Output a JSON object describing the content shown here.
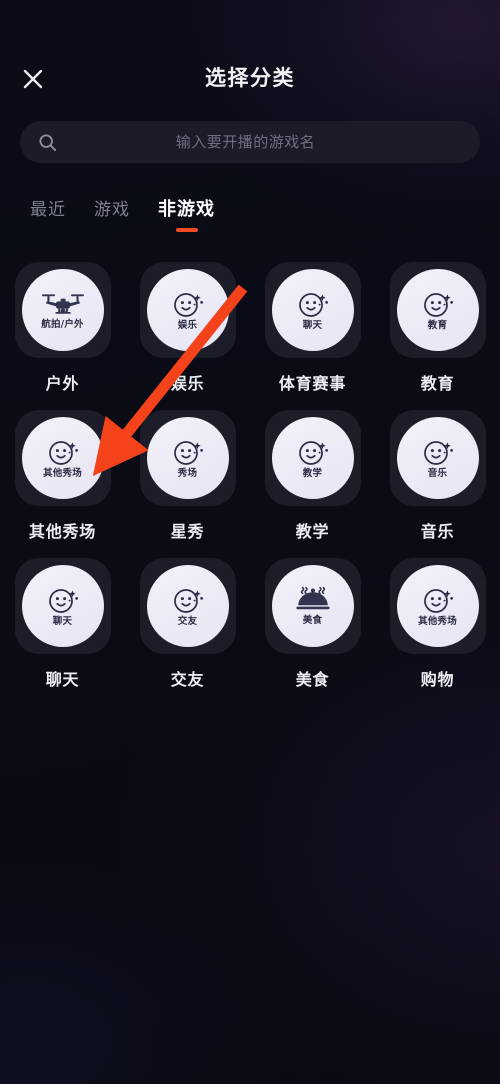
{
  "header": {
    "title": "选择分类",
    "close_icon": "close-icon"
  },
  "search": {
    "icon": "search-icon",
    "value": "",
    "placeholder": "输入要开播的游戏名"
  },
  "tabs": {
    "items": [
      {
        "label": "最近",
        "active": false
      },
      {
        "label": "游戏",
        "active": false
      },
      {
        "label": "非游戏",
        "active": true
      }
    ],
    "active_index": 2,
    "indicator_color": "#f04a22"
  },
  "categories": {
    "rows": [
      [
        {
          "label": "户外",
          "icon": "drone-icon",
          "inner_text": "航拍/户外"
        },
        {
          "label": "娱乐",
          "icon": "smiley-icon",
          "inner_text": "娱乐"
        },
        {
          "label": "体育赛事",
          "icon": "smiley-icon",
          "inner_text": "聊天"
        },
        {
          "label": "教育",
          "icon": "smiley-icon",
          "inner_text": "教育"
        }
      ],
      [
        {
          "label": "其他秀场",
          "icon": "smiley-icon",
          "inner_text": "其他秀场"
        },
        {
          "label": "星秀",
          "icon": "smiley-icon",
          "inner_text": "秀场"
        },
        {
          "label": "教学",
          "icon": "smiley-icon",
          "inner_text": "教学"
        },
        {
          "label": "音乐",
          "icon": "smiley-icon",
          "inner_text": "音乐"
        }
      ],
      [
        {
          "label": "聊天",
          "icon": "smiley-icon",
          "inner_text": "聊天"
        },
        {
          "label": "交友",
          "icon": "smiley-icon",
          "inner_text": "交友"
        },
        {
          "label": "美食",
          "icon": "food-dome-icon",
          "inner_text": "美食"
        },
        {
          "label": "购物",
          "icon": "smiley-icon",
          "inner_text": "其他秀场"
        }
      ]
    ]
  },
  "annotation": {
    "arrow_icon": "red-arrow-icon",
    "color": "#f4421a",
    "points_to": "其他秀场"
  },
  "colors": {
    "background": "#090a14",
    "card": "#1c1d29",
    "circle": "#f0eef8",
    "accent": "#f04a22",
    "text_primary": "#eceef4",
    "text_muted": "#7e8090"
  }
}
